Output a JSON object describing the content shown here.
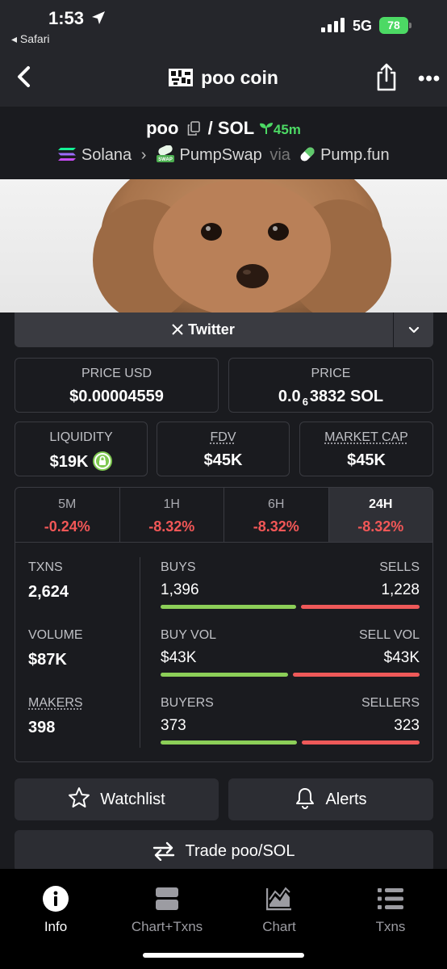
{
  "status_bar": {
    "time": "1:53",
    "back_app": "◂ Safari",
    "network": "5G",
    "battery": "78"
  },
  "nav": {
    "title": "poo coin"
  },
  "pair": {
    "base": "poo",
    "separator": "/",
    "quote": "SOL",
    "age": "45m",
    "chain": "Solana",
    "dex": "PumpSwap",
    "via_label": "via",
    "launchpad": "Pump.fun",
    "dex_badge": "SWAP"
  },
  "social": {
    "twitter_label": "Twitter"
  },
  "price": {
    "usd_label": "PRICE USD",
    "usd_value": "$0.00004559",
    "native_label": "PRICE",
    "native_prefix": "0.0",
    "native_zeros": "6",
    "native_digits": "3832",
    "native_unit": "SOL"
  },
  "metrics": {
    "liquidity_label": "LIQUIDITY",
    "liquidity_value": "$19K",
    "fdv_label": "FDV",
    "fdv_value": "$45K",
    "mcap_label": "MARKET CAP",
    "mcap_value": "$45K"
  },
  "timeframes": [
    {
      "label": "5M",
      "change": "-0.24%"
    },
    {
      "label": "1H",
      "change": "-8.32%"
    },
    {
      "label": "6H",
      "change": "-8.32%"
    },
    {
      "label": "24H",
      "change": "-8.32%"
    }
  ],
  "stats": {
    "txns_label": "TXNS",
    "txns_value": "2,624",
    "volume_label": "VOLUME",
    "volume_value": "$87K",
    "makers_label": "MAKERS",
    "makers_value": "398",
    "buys_label": "BUYS",
    "buys_value": "1,396",
    "sells_label": "SELLS",
    "sells_value": "1,228",
    "buy_vol_label": "BUY VOL",
    "buy_vol_value": "$43K",
    "sell_vol_label": "SELL VOL",
    "sell_vol_value": "$43K",
    "buyers_label": "BUYERS",
    "buyers_value": "373",
    "sellers_label": "SELLERS",
    "sellers_value": "323",
    "buys_ratio": 0.532,
    "buy_vol_ratio": 0.5,
    "buyers_ratio": 0.536
  },
  "actions": {
    "watchlist": "Watchlist",
    "alerts": "Alerts",
    "trade": "Trade poo/SOL"
  },
  "tabbar": [
    {
      "label": "Info",
      "icon": "info-icon"
    },
    {
      "label": "Chart+Txns",
      "icon": "chart-txns-icon"
    },
    {
      "label": "Chart",
      "icon": "chart-icon"
    },
    {
      "label": "Txns",
      "icon": "list-icon"
    }
  ],
  "colors": {
    "positive": "#8ccf58",
    "negative": "#ef5959",
    "background": "#1a1b1f",
    "card_border": "#3a3b41"
  }
}
